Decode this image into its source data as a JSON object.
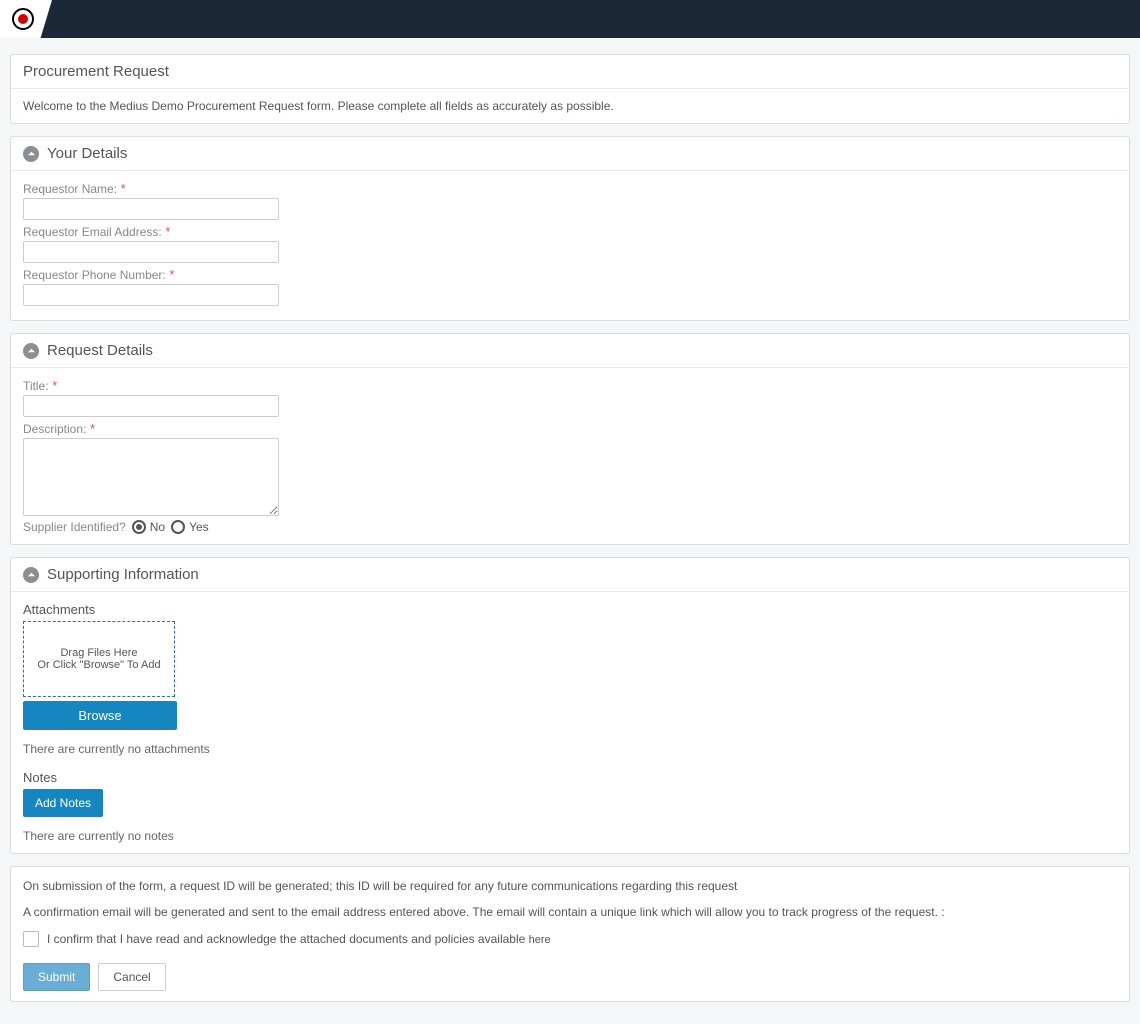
{
  "header": {
    "title": "Procurement Request",
    "intro": "Welcome to the Medius Demo Procurement Request form. Please complete all fields as accurately as possible."
  },
  "sections": {
    "yourDetails": {
      "title": "Your Details",
      "fields": {
        "name": {
          "label": "Requestor Name:",
          "value": ""
        },
        "email": {
          "label": "Requestor Email Address:",
          "value": ""
        },
        "phone": {
          "label": "Requestor Phone Number:",
          "value": ""
        }
      }
    },
    "requestDetails": {
      "title": "Request Details",
      "fields": {
        "title": {
          "label": "Title:",
          "value": ""
        },
        "description": {
          "label": "Description:",
          "value": ""
        },
        "supplier": {
          "label": "Supplier Identified?",
          "options": {
            "no": "No",
            "yes": "Yes"
          },
          "selected": "no"
        }
      }
    },
    "supporting": {
      "title": "Supporting Information",
      "attachments": {
        "label": "Attachments",
        "dragLine1": "Drag Files Here",
        "dragLine2": "Or Click \"Browse\" To Add",
        "browseLabel": "Browse",
        "emptyText": "There are currently no attachments"
      },
      "notes": {
        "label": "Notes",
        "addLabel": "Add Notes",
        "emptyText": "There are currently no notes"
      }
    }
  },
  "footer": {
    "line1": "On submission of the form, a request ID will be generated; this ID will be required for any future communications regarding this request",
    "line2": "A confirmation email will be generated and sent to the email address entered above. The email will contain a unique link which will allow you to track progress of the request. :",
    "confirmText": "I confirm that I have read and acknowledge the attached documents and policies available ",
    "hereLink": "here",
    "submitLabel": "Submit",
    "cancelLabel": "Cancel"
  }
}
